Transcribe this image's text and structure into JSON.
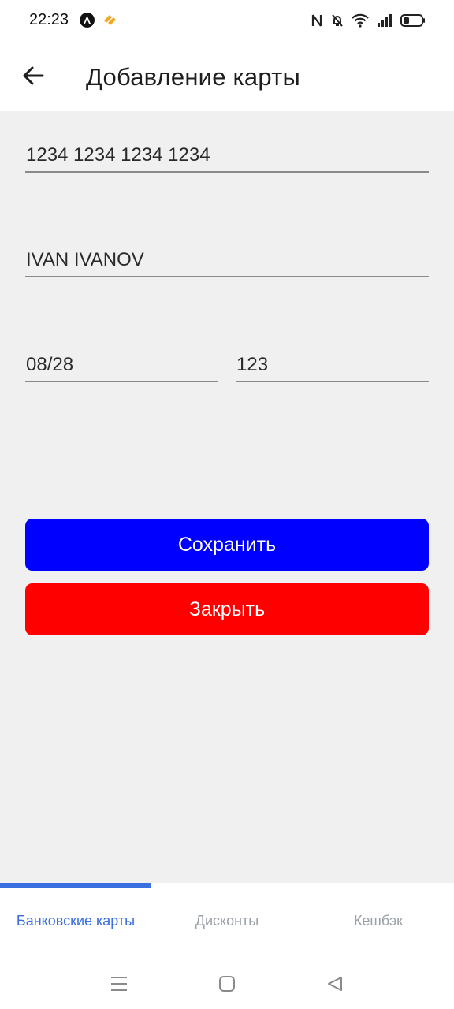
{
  "status_bar": {
    "time": "22:23"
  },
  "app_bar": {
    "title": "Добавление карты",
    "back_icon": "arrow-left-icon"
  },
  "form": {
    "card_number": "1234 1234 1234 1234",
    "card_holder": "IVAN IVANOV",
    "expiry": "08/28",
    "cvv": "123"
  },
  "buttons": {
    "save_label": "Сохранить",
    "close_label": "Закрыть",
    "save_color": "#0000ff",
    "close_color": "#ff0000"
  },
  "bottom_nav": {
    "items": [
      {
        "label": "Банковские карты",
        "active": true
      },
      {
        "label": "Дисконты",
        "active": false
      },
      {
        "label": "Кешбэк",
        "active": false
      }
    ],
    "accent_color": "#3a6fe0"
  },
  "system_nav": {
    "icons": [
      "menu-icon",
      "home-icon",
      "back-triangle-icon"
    ]
  }
}
